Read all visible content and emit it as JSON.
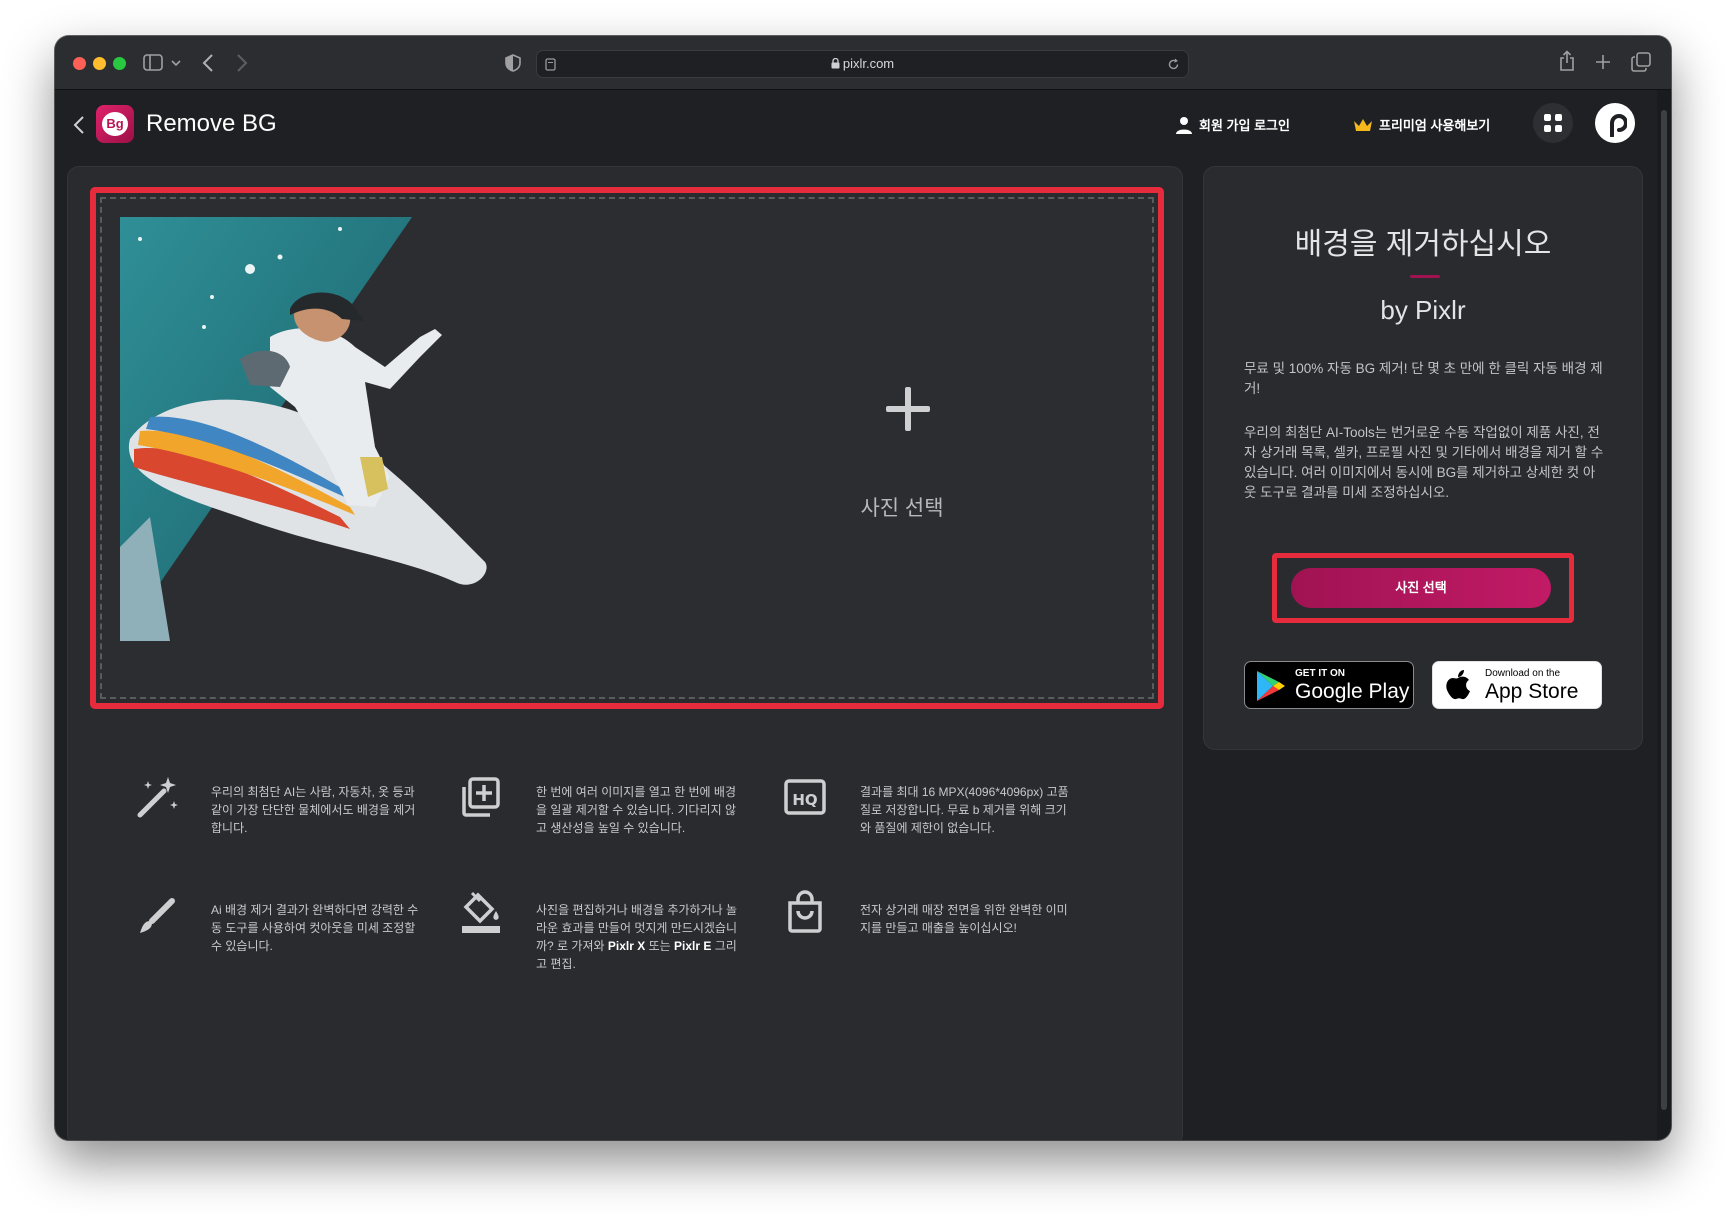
{
  "browser": {
    "url": "pixlr.com",
    "colors": {
      "close": "#fe5f57",
      "minimize": "#febc2e",
      "zoom": "#28c840"
    },
    "icons": [
      "sidebar-icon",
      "chevron-down-icon",
      "back-icon",
      "forward-icon",
      "shield-icon",
      "page-icon",
      "lock-icon",
      "reload-icon",
      "share-icon",
      "new-tab-icon",
      "tabs-icon"
    ]
  },
  "header": {
    "logo_text": "Bg",
    "title": "Remove BG",
    "signup_login": "회원 가입 로그인",
    "premium": "프리미엄 사용해보기"
  },
  "dropzone": {
    "choose_label": "사진 선택"
  },
  "features": [
    {
      "icon": "magic-wand-icon",
      "text": "우리의 최첨단 AI는 사람, 자동차, 옷 등과 같이 가장 단단한 물체에서도 배경을 제거합니다."
    },
    {
      "icon": "batch-add-icon",
      "text": "한 번에 여러 이미지를 열고 한 번에 배경을 일괄 제거할 수 있습니다. 기다리지 않고 생산성을 높일 수 있습니다."
    },
    {
      "icon": "hq-icon",
      "hq_label": "HQ",
      "text": "결과를 최대 16 MPX(4096*4096px) 고품질로 저장합니다. 무료 b 제거를 위해 크기와 품질에 제한이 없습니다."
    },
    {
      "icon": "brush-icon",
      "text": "Ai 배경 제거 결과가 완벽하다면 강력한 수동 도구를 사용하여 컷아웃을 미세 조정할 수 있습니다."
    },
    {
      "icon": "paint-bucket-icon",
      "text_a": "사진을 편집하거나 배경을 추가하거나 놀라운 효과를 만들어 멋지게 만드시겠습니까? 로 가져와 ",
      "link_x": "Pixlr X",
      "text_b": " 또는 ",
      "link_e": "Pixlr E",
      "text_c": " 그리고 편집."
    },
    {
      "icon": "shopping-bag-icon",
      "text": "전자 상거래 매장 전면을 위한 완벽한 이미지를 만들고 매출을 높이십시오!"
    }
  ],
  "side": {
    "title": "배경을 제거하십시오",
    "subtitle": "by Pixlr",
    "p1": "무료 및 100% 자동 BG 제거! 단 몇 초 만에 한 클릭 자동 배경 제거!",
    "p2": "우리의 최첨단 AI-Tools는 번거로운 수동 작업없이 제품 사진, 전자 상거래 목록, 셀카, 프로필 사진 및 기타에서 배경을 제거 할 수 있습니다. 여러 이미지에서 동시에 BG를 제거하고 상세한 컷 아웃 도구로 결과를 미세 조정하십시오.",
    "cta": "사진 선택",
    "google_small": "GET IT ON",
    "google_big": "Google Play",
    "apple_small": "Download on the",
    "apple_big": "App Store",
    "accent": "#b0175c"
  }
}
